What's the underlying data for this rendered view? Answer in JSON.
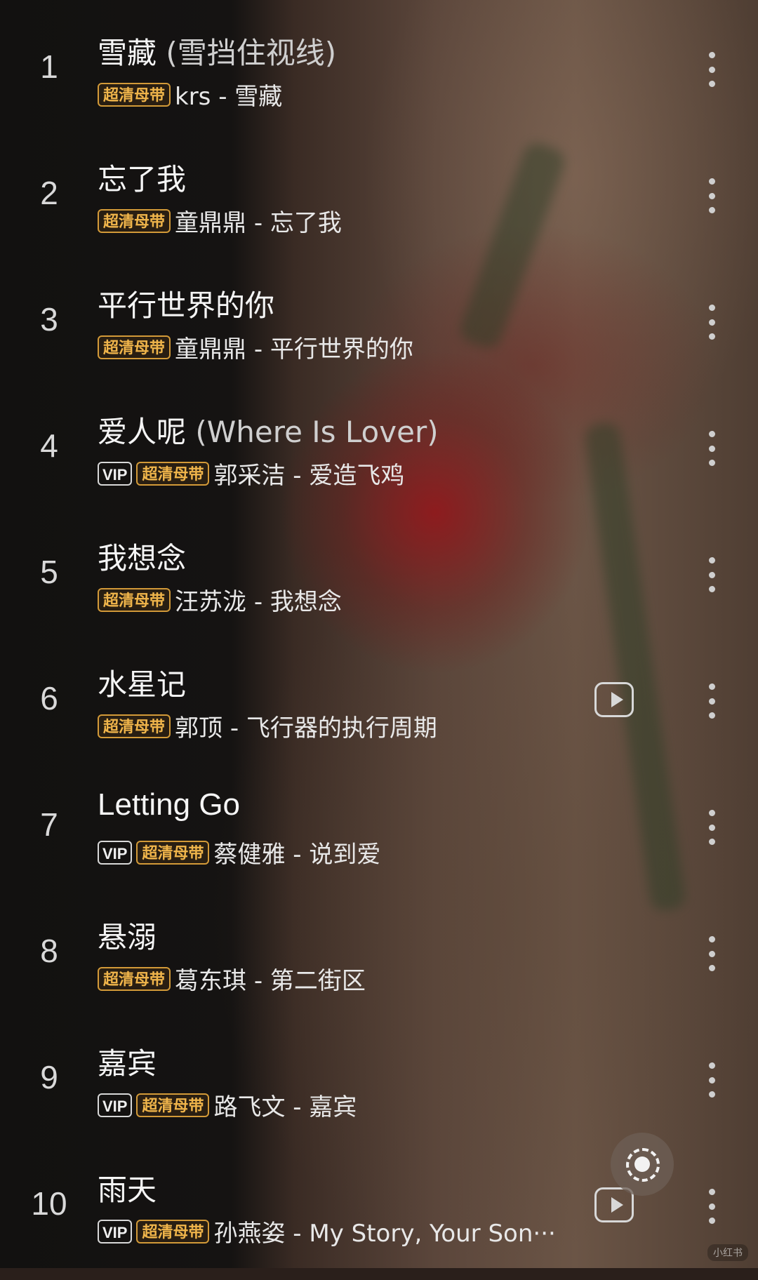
{
  "tracks": [
    {
      "num": "1",
      "title": "雪藏",
      "subtitle": " (雪挡住视线)",
      "vip": false,
      "hq": "超清母带",
      "meta": "krs - 雪藏",
      "mv": false
    },
    {
      "num": "2",
      "title": "忘了我",
      "subtitle": "",
      "vip": false,
      "hq": "超清母带",
      "meta": "童鼎鼎 - 忘了我",
      "mv": false
    },
    {
      "num": "3",
      "title": "平行世界的你",
      "subtitle": "",
      "vip": false,
      "hq": "超清母带",
      "meta": "童鼎鼎 - 平行世界的你",
      "mv": false
    },
    {
      "num": "4",
      "title": "爱人呢",
      "subtitle": " (Where Is Lover)",
      "vip": true,
      "hq": "超清母带",
      "meta": "郭采洁 - 爱造飞鸡",
      "mv": false
    },
    {
      "num": "5",
      "title": "我想念",
      "subtitle": "",
      "vip": false,
      "hq": "超清母带",
      "meta": "汪苏泷 - 我想念",
      "mv": false
    },
    {
      "num": "6",
      "title": "水星记",
      "subtitle": "",
      "vip": false,
      "hq": "超清母带",
      "meta": "郭顶 - 飞行器的执行周期",
      "mv": true
    },
    {
      "num": "7",
      "title": "Letting Go",
      "subtitle": "",
      "vip": true,
      "hq": "超清母带",
      "meta": "蔡健雅 - 说到爱",
      "mv": false
    },
    {
      "num": "8",
      "title": "悬溺",
      "subtitle": "",
      "vip": false,
      "hq": "超清母带",
      "meta": "葛东琪 - 第二街区",
      "mv": false
    },
    {
      "num": "9",
      "title": "嘉宾",
      "subtitle": "",
      "vip": true,
      "hq": "超清母带",
      "meta": "路飞文 - 嘉宾",
      "mv": false
    },
    {
      "num": "10",
      "title": "雨天",
      "subtitle": "",
      "vip": true,
      "hq": "超清母带",
      "meta": "孙燕姿 - My Story, Your Son···",
      "mv": true
    }
  ],
  "labels": {
    "vip": "VIP",
    "watermark": "小红书"
  },
  "icons": {
    "more": "more-vertical-icon",
    "mv": "play-video-icon",
    "locate": "locate-current-icon"
  },
  "colors": {
    "badge_gold": "#f0b54b",
    "text_primary": "#f5f5f5"
  }
}
